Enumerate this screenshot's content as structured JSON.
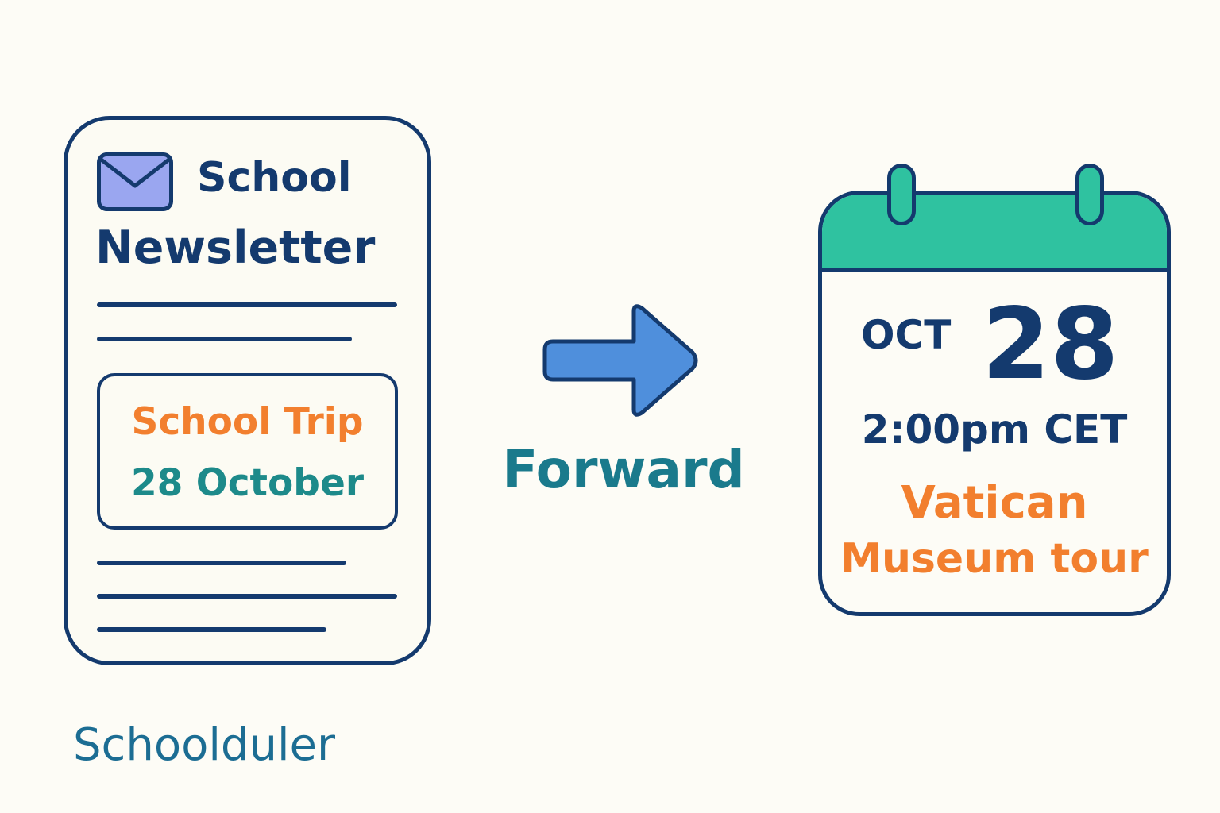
{
  "newsletter": {
    "title_line1": "School",
    "title_line2": "Newsletter",
    "highlight": {
      "title": "School Trip",
      "date": "28 October"
    }
  },
  "brand": "Schoolduler",
  "action": {
    "label": "Forward"
  },
  "calendar": {
    "month": "OCT",
    "day": "28",
    "time": "2:00pm CET",
    "event_line1": "Vatican",
    "event_line2": "Museum tour"
  },
  "icons": [
    "envelope-icon",
    "arrow-right-icon",
    "calendar-icon"
  ],
  "colors": {
    "navy": "#143a6e",
    "orange": "#f27f2e",
    "teal": "#1d8a8a",
    "calendar_header": "#2fc2a0",
    "arrow": "#4f8fdc",
    "envelope": "#9aa6f0",
    "background": "#fdfcf6"
  }
}
